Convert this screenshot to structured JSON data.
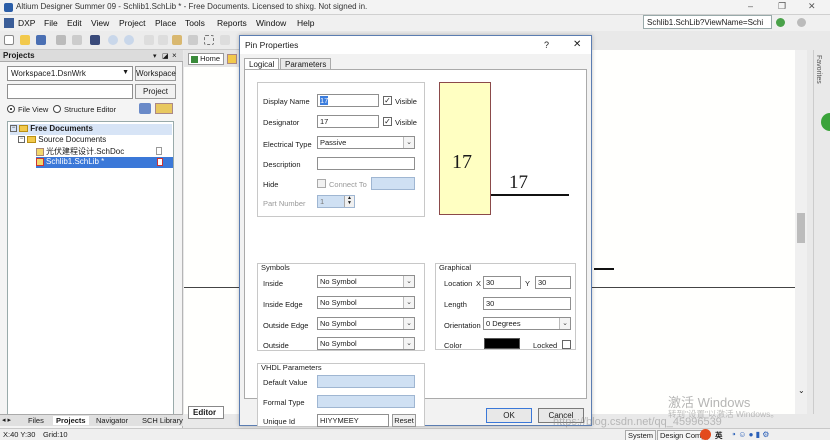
{
  "app": {
    "title": "Altium Designer Summer 09 - Schlib1.SchLib * - Free Documents. Licensed to shixg. Not signed in.",
    "window_controls": {
      "minimize": "–",
      "restore": "❐",
      "close": "✕"
    }
  },
  "menu": {
    "items": [
      "DXP",
      "File",
      "Edit",
      "View",
      "Project",
      "Place",
      "Tools",
      "Reports",
      "Window",
      "Help"
    ]
  },
  "address": {
    "value": "Schlib1.SchLib?ViewName=Schi"
  },
  "projects_panel": {
    "title": "Projects",
    "workspace_value": "Workspace1.DsnWrk",
    "workspace_button": "Workspace",
    "project_button": "Project",
    "view_file": "File View",
    "view_structure": "Structure Editor",
    "tree": [
      {
        "label": "Free Documents",
        "level": 0,
        "bold": true,
        "selected_header": true
      },
      {
        "label": "Source Documents",
        "level": 1
      },
      {
        "label": "光伏建程设计.SchDoc",
        "level": 2
      },
      {
        "label": "Schlib1.SchLib *",
        "level": 2,
        "selected": true
      }
    ],
    "bottom_tabs": [
      "Files",
      "Projects",
      "Navigator",
      "SCH Library"
    ]
  },
  "document_tabs": {
    "home": "Home",
    "editor": "Editor"
  },
  "status": {
    "coords": "X:40 Y:30",
    "grid": "Grid:10",
    "system": "System",
    "design": "Design Comp",
    "ime": "英"
  },
  "favorites_label": "Favorites",
  "dialog": {
    "title": "Pin Properties",
    "help": "?",
    "close": "✕",
    "tabs": [
      "Logical",
      "Parameters"
    ],
    "fields": {
      "display_name_label": "Display Name",
      "display_name_value": "17",
      "visible_label": "Visible",
      "designator_label": "Designator",
      "designator_value": "17",
      "electrical_type_label": "Electrical Type",
      "electrical_type_value": "Passive",
      "description_label": "Description",
      "description_value": "",
      "hide_label": "Hide",
      "connect_to_label": "Connect To",
      "part_number_label": "Part Number",
      "part_number_value": "1"
    },
    "preview": {
      "pin_name": "17",
      "pin_number": "17"
    },
    "symbols": {
      "title": "Symbols",
      "rows": [
        {
          "label": "Inside",
          "value": "No Symbol"
        },
        {
          "label": "Inside Edge",
          "value": "No Symbol"
        },
        {
          "label": "Outside Edge",
          "value": "No Symbol"
        },
        {
          "label": "Outside",
          "value": "No Symbol"
        }
      ]
    },
    "graphical": {
      "title": "Graphical",
      "location_label": "Location",
      "x_label": "X",
      "x_value": "30",
      "y_label": "Y",
      "y_value": "30",
      "length_label": "Length",
      "length_value": "30",
      "orientation_label": "Orientation",
      "orientation_value": "0 Degrees",
      "color_label": "Color",
      "color_value": "#000000",
      "locked_label": "Locked"
    },
    "vhdl": {
      "title": "VHDL Parameters",
      "default_value_label": "Default Value",
      "formal_type_label": "Formal Type",
      "unique_id_label": "Unique Id",
      "unique_id_value": "HIYYMEEY",
      "reset_button": "Reset"
    },
    "ok": "OK",
    "cancel": "Cancel"
  },
  "watermark": {
    "line1": "激活 Windows",
    "line2": "转到\"设置\"以激活 Windows。",
    "url": "https://blog.csdn.net/qq_45996539"
  }
}
